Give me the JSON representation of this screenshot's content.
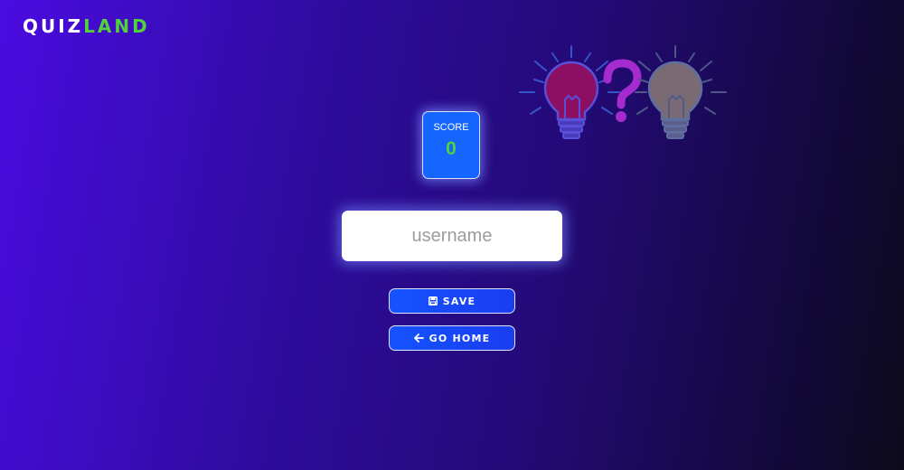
{
  "brand": {
    "logo_part1": "QUIZ",
    "logo_part2": "LAND"
  },
  "hero": {
    "icon": "lightbulbs-question-mark-illustration"
  },
  "score": {
    "label": "SCORE",
    "value": "0"
  },
  "form": {
    "username_placeholder": "username",
    "username_value": ""
  },
  "buttons": {
    "save": {
      "label": "SAVE",
      "icon": "floppy-disk-icon"
    },
    "home": {
      "label": "GO HOME",
      "icon": "arrow-left-icon"
    }
  },
  "colors": {
    "accent_green": "#53d13b",
    "button_blue": "#1553ff",
    "score_card_blue": "#1565ff",
    "bg_start": "#4a0be0",
    "bg_end": "#0d0a1c"
  }
}
